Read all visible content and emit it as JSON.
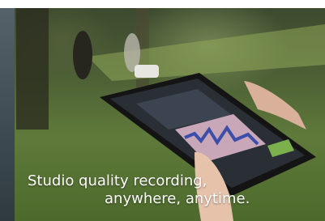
{
  "photo": {
    "description_icon": "ipad-recording-app-photo"
  },
  "caption": {
    "line1": "Studio quality recording,",
    "line2": "anywhere, anytime."
  }
}
